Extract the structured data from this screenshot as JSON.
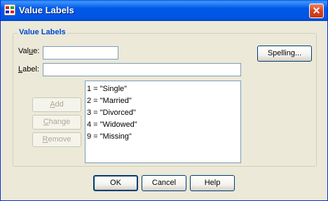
{
  "window": {
    "title": "Value Labels",
    "close_glyph": "✕"
  },
  "group": {
    "legend": "Value Labels"
  },
  "value_field": {
    "label_pre": "Val",
    "label_key": "u",
    "label_post": "e:",
    "value": ""
  },
  "label_field": {
    "label_key": "L",
    "label_post": "abel:",
    "value": ""
  },
  "buttons": {
    "spelling": "Spelling...",
    "add_key": "A",
    "add_rest": "dd",
    "change_key": "C",
    "change_rest": "hange",
    "remove_key": "R",
    "remove_rest": "emove",
    "ok": "OK",
    "cancel": "Cancel",
    "help": "Help"
  },
  "value_labels": [
    "1 = \"Single\"",
    "2 = \"Married\"",
    "3 = \"Divorced\"",
    "4 = \"Widowed\"",
    "9 = \"Missing\""
  ],
  "colors": {
    "titlebar": "#0054e3",
    "dialog_bg": "#ece9d8",
    "legend_text": "#0046d5",
    "close_button": "#d8411e"
  }
}
